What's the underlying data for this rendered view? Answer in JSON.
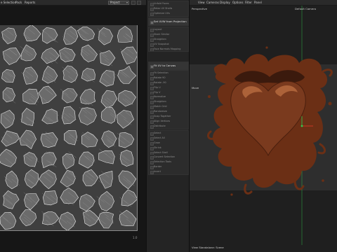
{
  "menubar": {
    "left_items": [
      "e Selection",
      "Pack",
      "Reports"
    ],
    "right_items": [
      "View",
      "Cameras",
      "Display",
      "Options",
      "Filter",
      "Panel"
    ]
  },
  "uv_editor": {
    "project_select": "Project",
    "scale_label": "1.0"
  },
  "side_panel": {
    "groups": [
      {
        "rows": [
          "Unfold Faces",
          "Relax UV Shells",
          "Optimize UVs"
        ]
      },
      {
        "rows": [
          "Set UVW from Projection"
        ],
        "bright": true
      },
      {
        "rows": [
          "Layout",
          "Stack Similar",
          "Straighten",
          "UV Snapshot",
          "Face Normals Mapping"
        ]
      },
      {
        "rows": [
          "Fit UV to Canvas"
        ],
        "bright": true
      },
      {
        "rows": [
          "Fit Selection",
          "Rotate 90",
          "Rotate -90",
          "Flip U",
          "Flip V",
          "Normalize",
          "Straighten",
          "Match Grid",
          "Randomize",
          "Snap Together",
          "Align Vertices",
          "Distribute"
        ]
      },
      {
        "rows": [
          "Select",
          "Select All",
          "Grow",
          "Shrink",
          "Select Shell",
          "Convert Selection",
          "Selection Tools",
          "Border",
          "Invert"
        ]
      }
    ]
  },
  "viewport": {
    "camera_view": "Perspective",
    "camera_name": "Default Camera",
    "mode_label": "Move",
    "footer_label": "View Standalone: Scene"
  },
  "colors": {
    "uv_background": "#3f3f3f",
    "uv_shell_fill": "#6b6b6b",
    "uv_shell_edge": "#e8e8e8",
    "chocolate_dark": "#3b1a0d",
    "chocolate_mid": "#7a3a1e",
    "chocolate_light": "#b56a3e",
    "gizmo_green": "#2fcf4f",
    "gizmo_red": "#e03a2a"
  }
}
